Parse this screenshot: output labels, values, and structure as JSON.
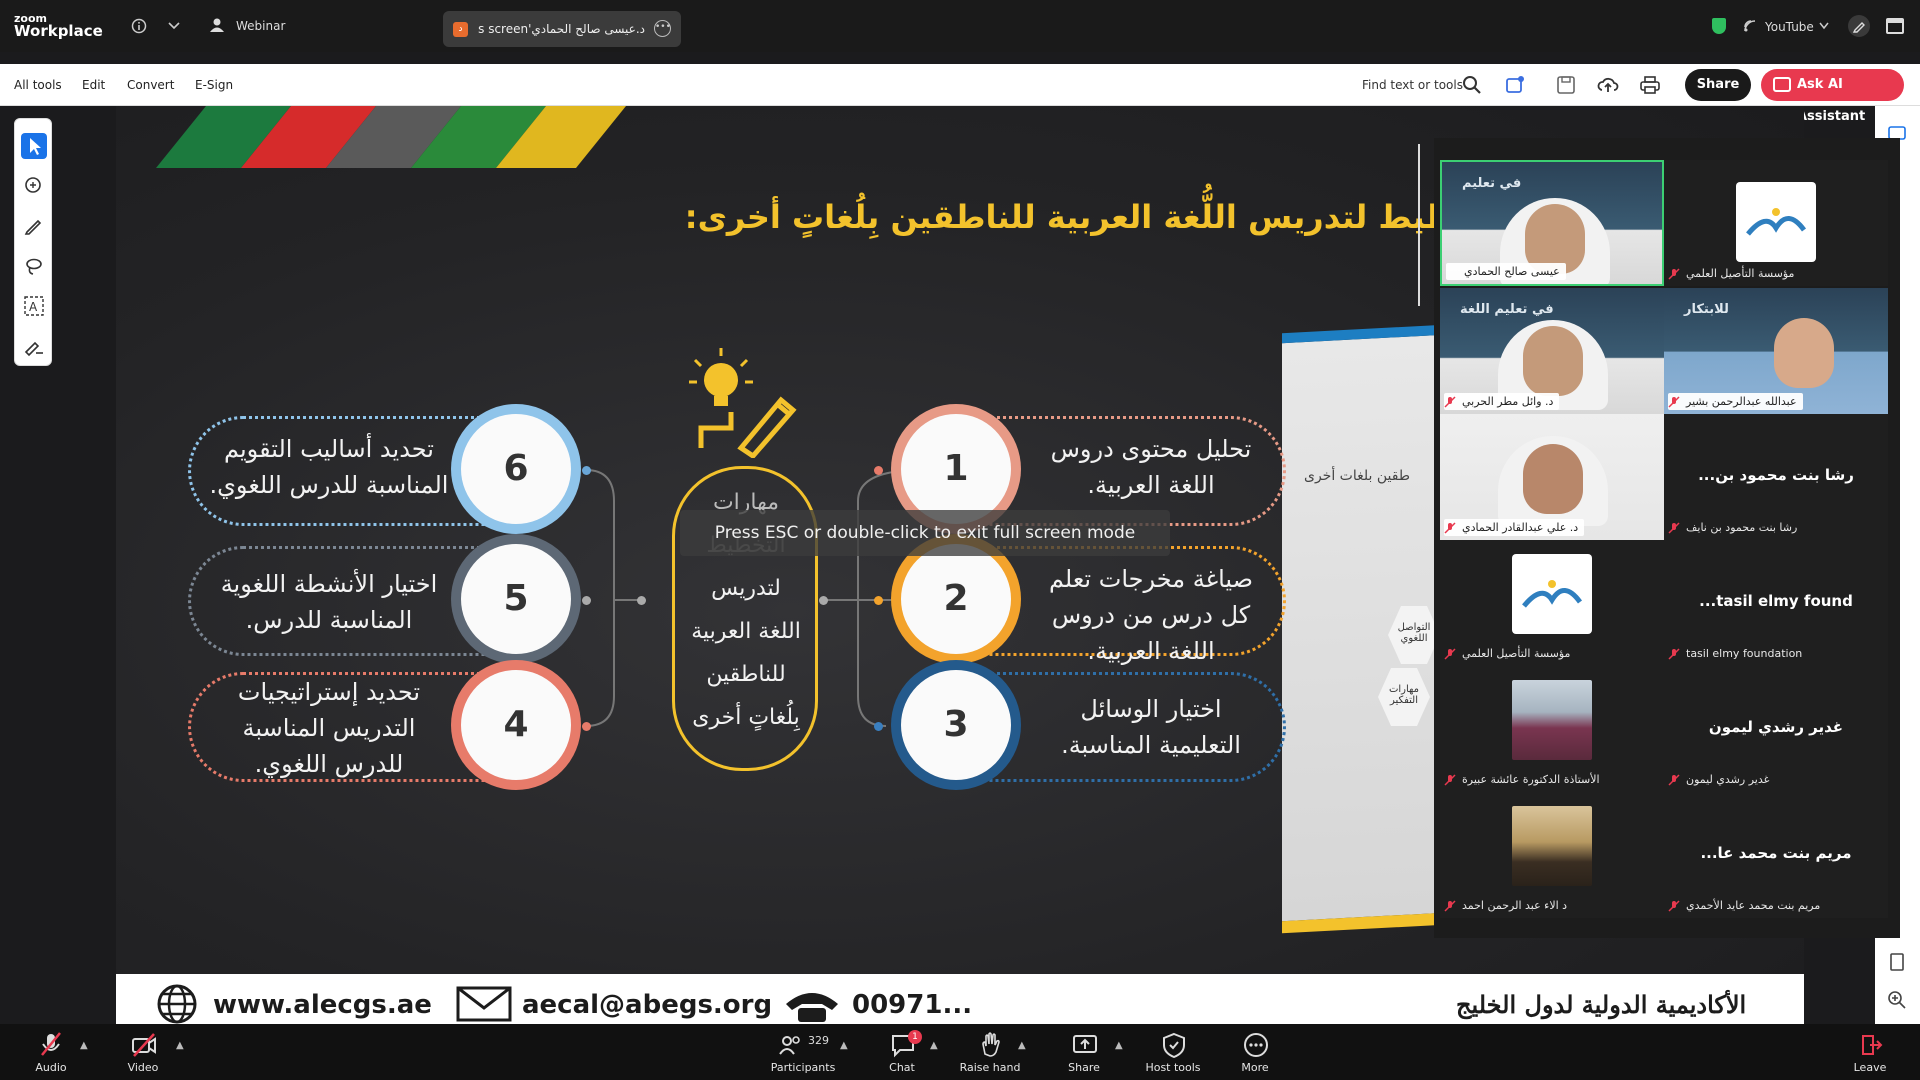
{
  "zoom_top": {
    "logo_line1": "zoom",
    "logo_line2": "Workplace",
    "webinar_label": "Webinar",
    "screen_tab_badge": "د",
    "screen_tab_label": "د.عيسى صالح الحمادي's screen",
    "youtube_label": "YouTube"
  },
  "acrobat": {
    "menu": [
      "All tools",
      "Edit",
      "Convert",
      "E-Sign"
    ],
    "find_text": "Find text or tools",
    "share_label": "Share",
    "ask_ai_label": "Ask AI Assistant"
  },
  "slide": {
    "title": "التخطيط لتدريس اللُّغة العربية للناطقين بِلُغاتٍ أخرى:",
    "center_lines": [
      "مهارات",
      "التخطيط",
      "لتدريس",
      "اللغة العربية",
      "للناطقين",
      "بِلُغاتٍ أخرى"
    ],
    "items": [
      {
        "number": "1",
        "line1": "تحليل محتوى دروس",
        "line2": "اللغة العربية.",
        "line3": ""
      },
      {
        "number": "2",
        "line1": "صياغة مخرجات تعلم",
        "line2": "كل درس من دروس",
        "line3": "اللغة العربية."
      },
      {
        "number": "3",
        "line1": "اختيار الوسائل",
        "line2": "التعليمية المناسبة.",
        "line3": ""
      },
      {
        "number": "4",
        "line1": "تحديد إستراتيجيات",
        "line2": "التدريس المناسبة",
        "line3": "للدرس اللغوي."
      },
      {
        "number": "5",
        "line1": "اختيار الأنشطة اللغوية",
        "line2": "المناسبة للدرس.",
        "line3": ""
      },
      {
        "number": "6",
        "line1": "تحديد أساليب التقويم",
        "line2": "المناسبة للدرس اللغوي.",
        "line3": ""
      }
    ],
    "esc_notice": "Press ESC or double-click to exit full screen mode",
    "book_label": "طقين بلغات أخرى",
    "side_hex_1": "التواصل اللغوي",
    "side_hex_2": "مهارات التفكير",
    "footer_web": "www.alecgs.ae",
    "footer_mail": "aecal@abegs.org",
    "footer_phone": "00971...",
    "footer_right": "الأكاديمية الدولية لدول الخليج"
  },
  "gallery": {
    "tiles": [
      {
        "name": "عيسى صالح الحمادي",
        "type": "video"
      },
      {
        "name": "مؤسسة التأصيل العلمي",
        "type": "logo"
      },
      {
        "name": "د. وائل مطر الحربي",
        "type": "video"
      },
      {
        "name": "عبدالله عبدالرحمن بشير",
        "type": "video"
      },
      {
        "name": "د. علي عبدالقادر الحمادي",
        "type": "video"
      },
      {
        "name": "رشا بنت محمود بن نايف",
        "center": "رشا بنت محمود بن...",
        "type": "name"
      },
      {
        "name": "مؤسسة التأصيل العلمي",
        "type": "logo"
      },
      {
        "name": "tasil elmy foundation",
        "center": "tasil elmy found...",
        "type": "name"
      },
      {
        "name": "الأستاذة الدكتورة عائشة عبيرة",
        "type": "photo"
      },
      {
        "name": "غدير رشدي ليمون",
        "center": "غدير رشدي ليمون",
        "type": "name"
      },
      {
        "name": "د الاء عبد الرحمن احمد",
        "type": "photo"
      },
      {
        "name": "مريم بنت محمد عايد الأحمدي",
        "center": "مريم بنت محمد عا...",
        "type": "name"
      }
    ]
  },
  "zoom_bottom": {
    "audio": "Audio",
    "video": "Video",
    "participants": "Participants",
    "participants_count": "329",
    "chat": "Chat",
    "chat_badge": "1",
    "raise_hand": "Raise hand",
    "share": "Share",
    "host_tools": "Host tools",
    "more": "More",
    "leave": "Leave"
  },
  "colors": {
    "accent_yellow": "#f3c22c",
    "ask_ai_red": "#e8394f",
    "active_speaker_green": "#3ccf73"
  }
}
